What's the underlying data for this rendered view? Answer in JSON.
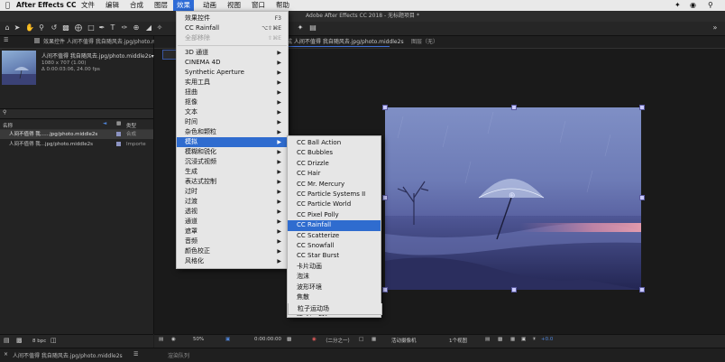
{
  "menubar": {
    "app": "After Effects CC",
    "items": [
      "文件",
      "编辑",
      "合成",
      "图层",
      "效果",
      "动画",
      "视图",
      "窗口",
      "帮助"
    ],
    "active_index": 4
  },
  "window_title": "Adobe After Effects CC 2018 - 无标题项目 *",
  "project_panel": {
    "tab_label": "效果控件 人间不值得 我自随风去.jpg/photo.middle2s",
    "item_name": "人间不值得 我自随风去.jpg/photo.middle2s▾",
    "meta": [
      "1080 x 707 (1.00)",
      "Δ 0:00:03:06, 24.00 fps"
    ],
    "columns": {
      "name": "名称",
      "type": "类型"
    },
    "rows": [
      {
        "name": "人间不值得 我......jpg/photo.middle2s",
        "type": "合成",
        "selected": true
      },
      {
        "name": "人间不值得 我...jpg/photo.middle2s",
        "type": "Importe",
        "selected": false
      }
    ],
    "bottom_bpc": "8 bpc"
  },
  "composition": {
    "tab_label": "合成 人间不值得 我自随风去.jpg/photo.middle2s",
    "layer_tab": "图层（无）",
    "viewer": {
      "zoom": "50%",
      "timecode": "0:00:00:00",
      "resolution": "（二分之一）",
      "camera": "活动摄像机",
      "views": "1个视图",
      "exposure": "+0.0"
    }
  },
  "timeline": {
    "tab_label": "人间不值得 我自随风去.jpg/photo.middle2s",
    "render_queue": "渲染队列"
  },
  "effect_menu": {
    "items": [
      {
        "label": "效果控件",
        "shortcut": "F3",
        "disabled": false
      },
      {
        "label": "CC Rainfall",
        "shortcut": "⌥⇧⌘E",
        "disabled": false
      },
      {
        "label": "全部移除",
        "shortcut": "⇧⌘E",
        "disabled": true
      },
      {
        "label": "3D 通道",
        "submenu": true
      },
      {
        "label": "CINEMA 4D",
        "submenu": true
      },
      {
        "label": "Synthetic Aperture",
        "submenu": true
      },
      {
        "label": "实用工具",
        "submenu": true
      },
      {
        "label": "扭曲",
        "submenu": true
      },
      {
        "label": "抠像",
        "submenu": true
      },
      {
        "label": "文本",
        "submenu": true
      },
      {
        "label": "时间",
        "submenu": true
      },
      {
        "label": "杂色和颗粒",
        "submenu": true
      },
      {
        "label": "模拟",
        "submenu": true,
        "selected": true
      },
      {
        "label": "模糊和锐化",
        "submenu": true
      },
      {
        "label": "沉浸式视频",
        "submenu": true
      },
      {
        "label": "生成",
        "submenu": true
      },
      {
        "label": "表达式控制",
        "submenu": true
      },
      {
        "label": "过时",
        "submenu": true
      },
      {
        "label": "过渡",
        "submenu": true
      },
      {
        "label": "透视",
        "submenu": true
      },
      {
        "label": "通道",
        "submenu": true
      },
      {
        "label": "遮罩",
        "submenu": true
      },
      {
        "label": "音频",
        "submenu": true
      },
      {
        "label": "颜色校正",
        "submenu": true
      },
      {
        "label": "风格化",
        "submenu": true
      }
    ]
  },
  "simulate_submenu": {
    "items": [
      {
        "label": "CC Ball Action"
      },
      {
        "label": "CC Bubbles"
      },
      {
        "label": "CC Drizzle"
      },
      {
        "label": "CC Hair"
      },
      {
        "label": "CC Mr. Mercury"
      },
      {
        "label": "CC Particle Systems II"
      },
      {
        "label": "CC Particle World"
      },
      {
        "label": "CC Pixel Polly"
      },
      {
        "label": "CC Rainfall",
        "selected": true
      },
      {
        "label": "CC Scatterize"
      },
      {
        "label": "CC Snowfall"
      },
      {
        "label": "CC Star Burst"
      },
      {
        "label": "卡片动画"
      },
      {
        "label": "泡沫"
      },
      {
        "label": "波形环境"
      },
      {
        "label": "焦散"
      },
      {
        "label": "碎片"
      },
      {
        "label": "粒子运动场"
      }
    ]
  }
}
